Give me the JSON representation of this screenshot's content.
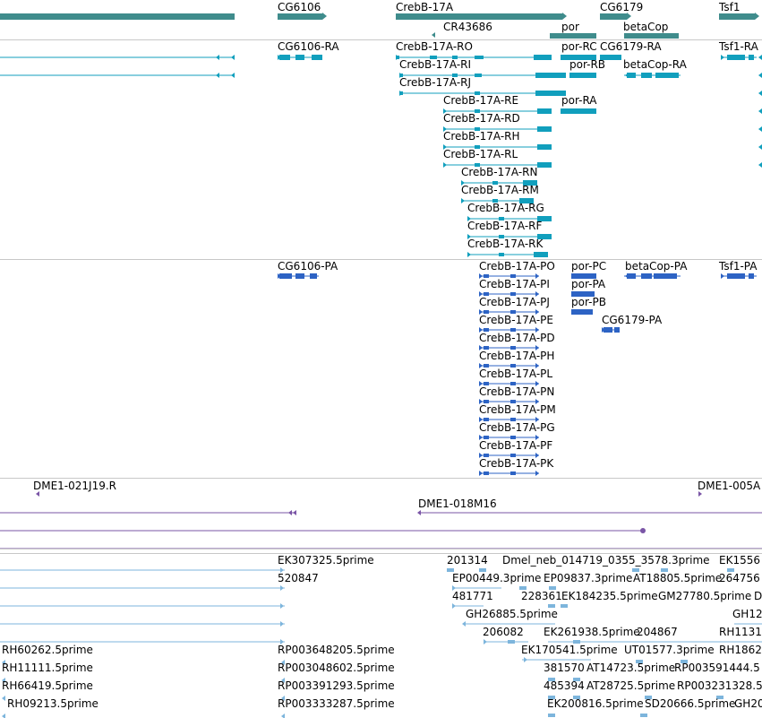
{
  "palette": {
    "gene": "#3f8c8c",
    "transcript": "#119fbd",
    "protein": "#2d63c4",
    "clone": "#7a55a6",
    "est": "#7db5dc",
    "separator": "#c8c8c8"
  },
  "tracks": {
    "genes": [
      {
        "id": "cg6106",
        "label": "CG6106"
      },
      {
        "id": "crebb",
        "label": "CrebB-17A"
      },
      {
        "id": "cr43686",
        "label": "CR43686"
      },
      {
        "id": "por",
        "label": "por"
      },
      {
        "id": "cg6179",
        "label": "CG6179"
      },
      {
        "id": "betacop",
        "label": "betaCop"
      },
      {
        "id": "tsf1",
        "label": "Tsf1"
      }
    ],
    "transcripts": [
      {
        "id": "cg6106-ra",
        "label": "CG6106-RA"
      },
      {
        "id": "crebb-ro",
        "label": "CrebB-17A-RO"
      },
      {
        "id": "por-rc",
        "label": "por-RC"
      },
      {
        "id": "cg6179-ra",
        "label": "CG6179-RA"
      },
      {
        "id": "tsf1-ra",
        "label": "Tsf1-RA"
      },
      {
        "id": "crebb-ri",
        "label": "CrebB-17A-RI"
      },
      {
        "id": "por-rb",
        "label": "por-RB"
      },
      {
        "id": "betacop-ra",
        "label": "betaCop-RA"
      },
      {
        "id": "crebb-rj",
        "label": "CrebB-17A-RJ"
      },
      {
        "id": "crebb-re",
        "label": "CrebB-17A-RE"
      },
      {
        "id": "por-ra",
        "label": "por-RA"
      },
      {
        "id": "crebb-rd",
        "label": "CrebB-17A-RD"
      },
      {
        "id": "crebb-rh",
        "label": "CrebB-17A-RH"
      },
      {
        "id": "crebb-rl",
        "label": "CrebB-17A-RL"
      },
      {
        "id": "crebb-rn",
        "label": "CrebB-17A-RN"
      },
      {
        "id": "crebb-rm",
        "label": "CrebB-17A-RM"
      },
      {
        "id": "crebb-rg",
        "label": "CrebB-17A-RG"
      },
      {
        "id": "crebb-rf",
        "label": "CrebB-17A-RF"
      },
      {
        "id": "crebb-rk",
        "label": "CrebB-17A-RK"
      }
    ],
    "proteins": [
      {
        "id": "cg6106-pa",
        "label": "CG6106-PA"
      },
      {
        "id": "crebb-po",
        "label": "CrebB-17A-PO"
      },
      {
        "id": "por-pc",
        "label": "por-PC"
      },
      {
        "id": "betacop-pa",
        "label": "betaCop-PA"
      },
      {
        "id": "tsf1-pa",
        "label": "Tsf1-PA"
      },
      {
        "id": "crebb-pi",
        "label": "CrebB-17A-PI"
      },
      {
        "id": "por-pa",
        "label": "por-PA"
      },
      {
        "id": "crebb-pj",
        "label": "CrebB-17A-PJ"
      },
      {
        "id": "por-pb",
        "label": "por-PB"
      },
      {
        "id": "crebb-pe",
        "label": "CrebB-17A-PE"
      },
      {
        "id": "cg6179-pa",
        "label": "CG6179-PA"
      },
      {
        "id": "crebb-pd",
        "label": "CrebB-17A-PD"
      },
      {
        "id": "crebb-ph",
        "label": "CrebB-17A-PH"
      },
      {
        "id": "crebb-pl",
        "label": "CrebB-17A-PL"
      },
      {
        "id": "crebb-pn",
        "label": "CrebB-17A-PN"
      },
      {
        "id": "crebb-pm",
        "label": "CrebB-17A-PM"
      },
      {
        "id": "crebb-pg",
        "label": "CrebB-17A-PG"
      },
      {
        "id": "crebb-pf",
        "label": "CrebB-17A-PF"
      },
      {
        "id": "crebb-pk",
        "label": "CrebB-17A-PK"
      }
    ],
    "clones": [
      {
        "id": "dme1-021j19",
        "label": "DME1-021J19.R"
      },
      {
        "id": "dme1-005a",
        "label": "DME1-005A"
      },
      {
        "id": "dme1-018m16",
        "label": "DME1-018M16"
      }
    ],
    "ests": [
      {
        "id": "ek307325",
        "label": "EK307325.5prime"
      },
      {
        "id": "201314",
        "label": "201314"
      },
      {
        "id": "dmel-neb",
        "label": "Dmel_neb_014719_0355_3578.3prime"
      },
      {
        "id": "ek1556",
        "label": "EK1556"
      },
      {
        "id": "520847",
        "label": "520847"
      },
      {
        "id": "ep00449",
        "label": "EP00449.3prime"
      },
      {
        "id": "ep09837",
        "label": "EP09837.3prime"
      },
      {
        "id": "at18805",
        "label": "AT18805.5prime"
      },
      {
        "id": "264756",
        "label": "264756"
      },
      {
        "id": "481771",
        "label": "481771"
      },
      {
        "id": "228361",
        "label": "228361"
      },
      {
        "id": "ek184235",
        "label": "EK184235.5prime"
      },
      {
        "id": "gm27780",
        "label": "GM27780.5prime"
      },
      {
        "id": "d-trunc",
        "label": "D"
      },
      {
        "id": "gh26885",
        "label": "GH26885.5prime"
      },
      {
        "id": "gh12",
        "label": "GH12"
      },
      {
        "id": "206082",
        "label": "206082"
      },
      {
        "id": "ek261938",
        "label": "EK261938.5prime"
      },
      {
        "id": "204867",
        "label": "204867"
      },
      {
        "id": "rh1131",
        "label": "RH1131"
      },
      {
        "id": "rh60262",
        "label": "RH60262.5prime"
      },
      {
        "id": "rp003648205",
        "label": "RP003648205.5prime"
      },
      {
        "id": "ek170541",
        "label": "EK170541.5prime"
      },
      {
        "id": "ut01577",
        "label": "UT01577.3prime"
      },
      {
        "id": "rh1862",
        "label": "RH1862"
      },
      {
        "id": "rh11111",
        "label": "RH11111.5prime"
      },
      {
        "id": "rp003048602",
        "label": "RP003048602.5prime"
      },
      {
        "id": "381570",
        "label": "381570"
      },
      {
        "id": "at14723",
        "label": "AT14723.5prime"
      },
      {
        "id": "rp003591444",
        "label": "RP003591444.5"
      },
      {
        "id": "rh66419",
        "label": "RH66419.5prime"
      },
      {
        "id": "rp003391293",
        "label": "RP003391293.5prime"
      },
      {
        "id": "485394",
        "label": "485394"
      },
      {
        "id": "at28725",
        "label": "AT28725.5prime"
      },
      {
        "id": "rp003231328",
        "label": "RP003231328.5"
      },
      {
        "id": "rh09213",
        "label": "RH09213.5prime"
      },
      {
        "id": "rp003333287",
        "label": "RP003333287.5prime"
      },
      {
        "id": "ek200816",
        "label": "EK200816.5prime"
      },
      {
        "id": "sd20666",
        "label": "SD20666.5prime"
      },
      {
        "id": "gh20",
        "label": "GH20"
      }
    ]
  }
}
